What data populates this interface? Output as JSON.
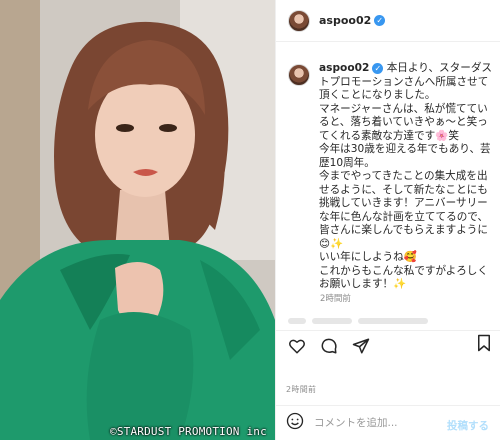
{
  "photo": {
    "credit": "©STARDUST PROMOTION inc"
  },
  "header": {
    "username": "aspoo02",
    "verified_glyph": "✓"
  },
  "caption": {
    "username": "aspoo02",
    "verified_glyph": "✓",
    "text": " 本日より、スターダストプロモーションさんへ所属させて頂くことになりました。\nマネージャーさんは、私が慌てていると、落ち着いていきやぁ～と笑ってくれる素敵な方達です🌸笑\n今年は30歳を迎える年でもあり、芸歴10周年。\n今までやってきたことの集大成を出せるように、そして新たなことにも挑戦していきます！アニバーサリーな年に色んな計画を立ててるので、皆さんに楽しんでもらえますように😊✨\nいい年にしようね🥰\nこれからもこんな私ですがよろしくお願いします！✨",
    "time": "2時間前"
  },
  "actions": {
    "like_icon": "heart-icon",
    "comment_icon": "comment-icon",
    "share_icon": "share-icon",
    "save_icon": "bookmark-icon"
  },
  "post_time": "2時間前",
  "comment": {
    "emoji_icon": "smiley-icon",
    "placeholder": "コメントを追加...",
    "post_label": "投稿する"
  },
  "colors": {
    "verified": "#3897f0",
    "post_button": "#b2dffc",
    "secondary_text": "#8e8e8e",
    "border": "#efefef"
  }
}
